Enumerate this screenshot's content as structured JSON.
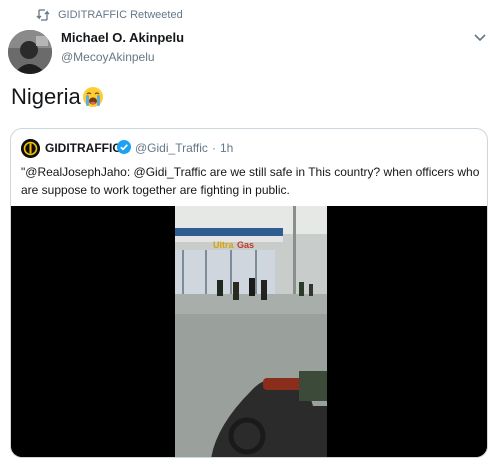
{
  "retweet": {
    "icon": "retweet-icon",
    "text": "GIDITRAFFIC Retweeted"
  },
  "author": {
    "name": "Michael O. Akinpelu",
    "handle": "@MecoyAkinpelu",
    "avatar_icon": "avatar-image"
  },
  "menu": {
    "icon": "chevron-down-icon"
  },
  "tweet": {
    "text": "Nigeria",
    "emoji": "loudly-crying-face-emoji"
  },
  "quote": {
    "name": "GIDITRAFFIC",
    "verified_icon": "verified-badge-icon",
    "handle": "@Gidi_Traffic",
    "separator": "·",
    "time": "1h",
    "text": "\"@RealJosephJaho: @Gidi_Traffic are we still safe in This country? when officers who are suppose to work together are fighting in public.",
    "media": {
      "type": "video",
      "sign_text": "Gas"
    }
  },
  "colors": {
    "primary_text": "#14171a",
    "secondary_text": "#657786",
    "border": "#ccd6dd",
    "verified": "#1da1f2"
  }
}
